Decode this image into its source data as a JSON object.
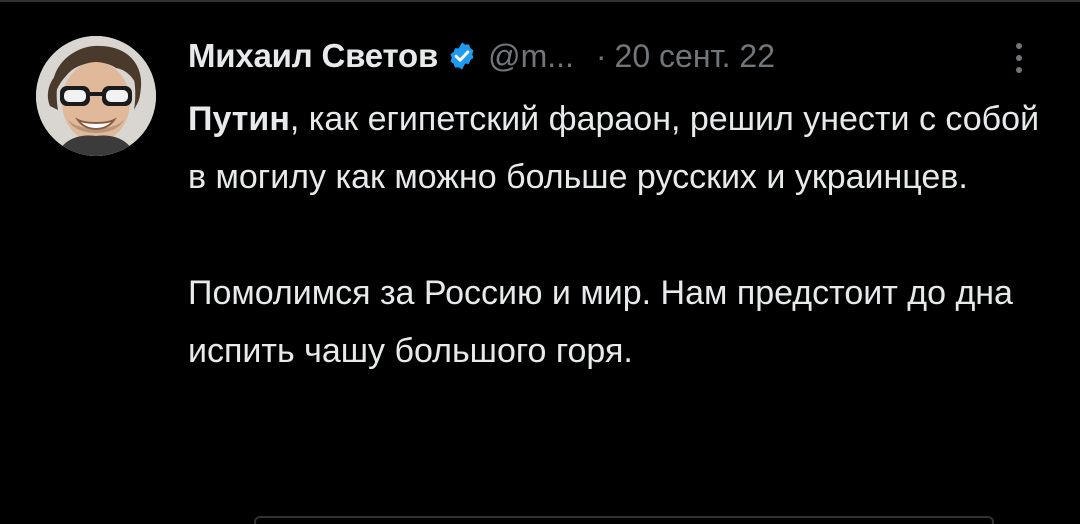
{
  "tweet": {
    "author_name": "Михаил Светов",
    "handle": "@m...",
    "separator": "·",
    "date": "20 сент. 22",
    "avatar_icon": "avatar-photo",
    "verified_icon": "verified-badge-icon",
    "more_icon": "more-vertical-icon",
    "paragraph1": {
      "bold": "Путин",
      "rest": ", как египетский фараон, решил унести с собой в могилу как можно больше русских и украинцев."
    },
    "paragraph2": "Помолимся за Россию и мир. Нам предстоит до дна испить чашу большого горя."
  },
  "colors": {
    "background": "#000000",
    "text": "#e7e9ea",
    "secondary_text": "#71767b",
    "verified_blue": "#1d9bf0"
  }
}
